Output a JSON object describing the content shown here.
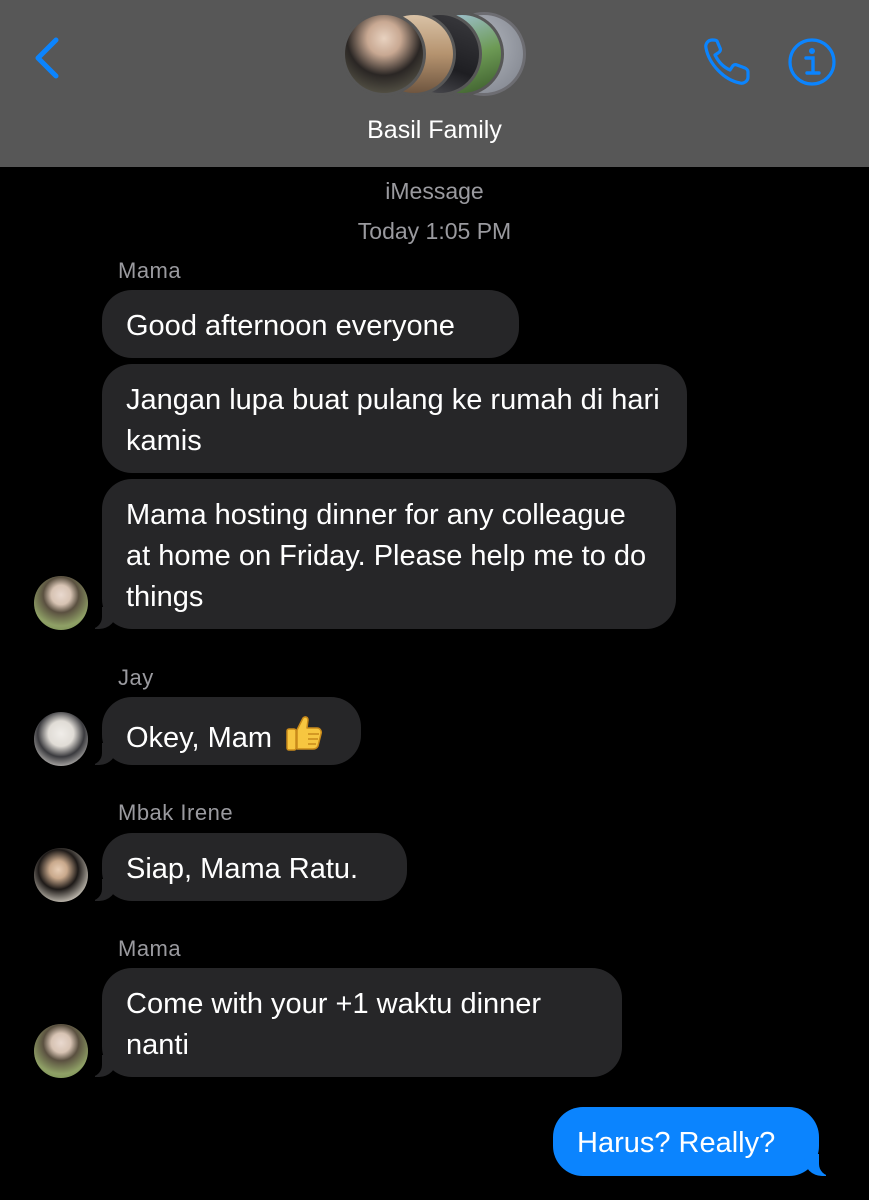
{
  "header": {
    "title": "Basil Family",
    "back_icon": "chevron-left-icon",
    "phone_icon": "phone-icon",
    "info_icon": "info-icon",
    "accent_color": "#0b84fe"
  },
  "conversation": {
    "service": "iMessage",
    "timestamp": "Today 1:05 PM"
  },
  "messages": [
    {
      "sender": "Mama",
      "texts": [
        "Good afternoon everyone",
        "Jangan lupa buat pulang ke rumah di hari kamis",
        "Mama hosting dinner for any colleague at home on Friday. Please help me to do things"
      ]
    },
    {
      "sender": "Jay",
      "texts": [
        "Okey, Mam"
      ],
      "emoji": "thumbs-up-icon"
    },
    {
      "sender": "Mbak Irene",
      "texts": [
        "Siap, Mama Ratu."
      ]
    },
    {
      "sender": "Mama",
      "texts": [
        "Come with your +1 waktu dinner nanti"
      ]
    }
  ],
  "outgoing": [
    {
      "text": "Harus? Really?"
    }
  ],
  "colors": {
    "header_bg": "#575757",
    "incoming_bubble": "#262628",
    "outgoing_bubble": "#0b84fe",
    "meta_text": "#9a9a9f"
  }
}
